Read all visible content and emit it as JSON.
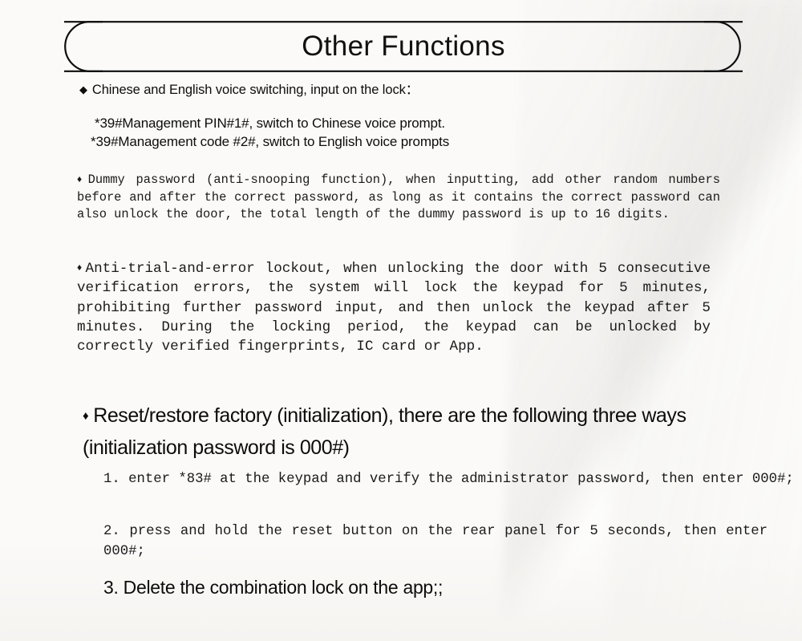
{
  "document": {
    "title": "Other Functions",
    "background_color": "#fbfaf8",
    "text_color": "#111111"
  },
  "sections": {
    "voice": {
      "bullet": "◆",
      "heading": "Chinese and English voice switching, input on the lock：",
      "lines": [
        "*39#Management PIN#1#, switch to Chinese voice prompt.",
        "*39#Management code #2#, switch to English voice prompts"
      ]
    },
    "dummy_password": {
      "bullet": "♦",
      "text": "Dummy password (anti-snooping function), when inputting, add other random numbers before and after the correct password, as long as it contains the correct password can also unlock the door, the total length of the dummy password is up to 16 digits."
    },
    "lockout": {
      "bullet": "♦",
      "text": "Anti-trial-and-error lockout, when unlocking the door with 5 consecutive verification errors, the system will lock the keypad for 5 minutes, prohibiting further password input, and then unlock the keypad after 5 minutes. During the locking period, the keypad can be unlocked by correctly verified fingerprints, IC card or App."
    },
    "reset": {
      "bullet": "♦",
      "heading": "Reset/restore factory (initialization), there are the following three ways (initialization password is 000#)",
      "steps": [
        "1. enter *83# at the keypad and verify the administrator password, then enter 000#;",
        "2. press and hold the reset button on the rear panel for 5 seconds, then enter 000#;",
        "3. Delete the combination lock on the app;;"
      ]
    }
  }
}
